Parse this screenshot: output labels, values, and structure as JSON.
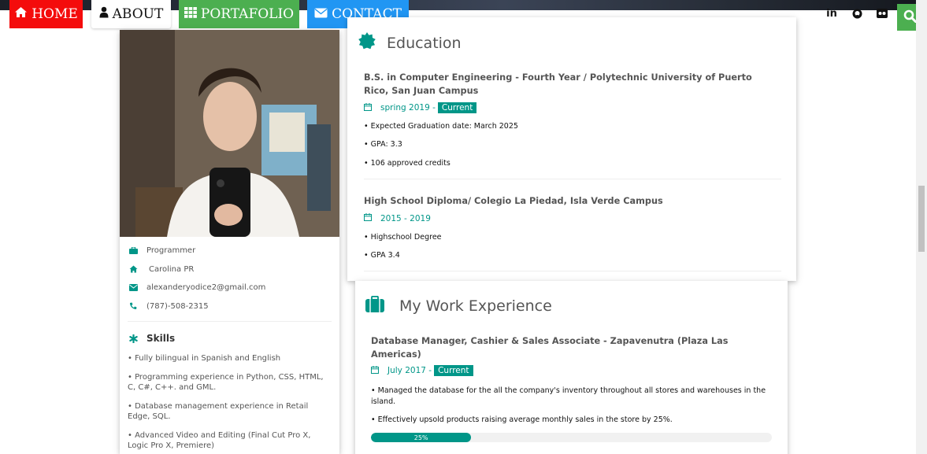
{
  "nav": {
    "home": "HOME",
    "about": "ABOUT",
    "portfolio": "PORTAFOLIO",
    "contact": "CONTACT"
  },
  "social": {
    "linkedin": "in"
  },
  "profile": {
    "occupation": "Programmer",
    "location": "Carolina PR",
    "email": "alexanderyodice2@gmail.com",
    "phone": "(787)-508-2315"
  },
  "skills": {
    "title": "Skills",
    "items": [
      "• Fully bilingual in Spanish and English",
      "• Programming experience in Python, CSS, HTML, C, C#, C++. and GML.",
      "• Database management experience in Retail Edge, SQL.",
      "• Advanced Video and Editing (Final Cut Pro X, Logic Pro X, Premiere)"
    ]
  },
  "education": {
    "title": "Education",
    "entries": [
      {
        "title": "B.S. in Computer Engineering - Fourth Year / Polytechnic University of Puerto Rico, San Juan Campus",
        "date": "spring 2019 -",
        "badge": "Current",
        "bullets": [
          "• Expected Graduation date: March 2025",
          "• GPA: 3.3",
          "• 106 approved credits"
        ]
      },
      {
        "title": "High School Diploma/ Colegio La Piedad, Isla Verde Campus",
        "date": "2015 - 2019",
        "bullets": [
          "• Highschool Degree",
          "• GPA 3.4"
        ]
      }
    ]
  },
  "work": {
    "title": "My Work Experience",
    "entries": [
      {
        "title": "Database Manager, Cashier & Sales Associate - Zapavenutra (Plaza Las Americas)",
        "date": "July 2017 -",
        "badge": "Current",
        "bullets": [
          "• Managed the database for the all the company's inventory throughout all stores and warehouses in the island.",
          "• Effectively upsold products raising average monthly sales in the store by 25%."
        ],
        "progress_label": "25%",
        "progress_value": 0.25
      }
    ]
  },
  "colors": {
    "accent": "#009688",
    "home": "#f40c0c",
    "portfolio": "#4caf50",
    "contact": "#2196f3"
  }
}
